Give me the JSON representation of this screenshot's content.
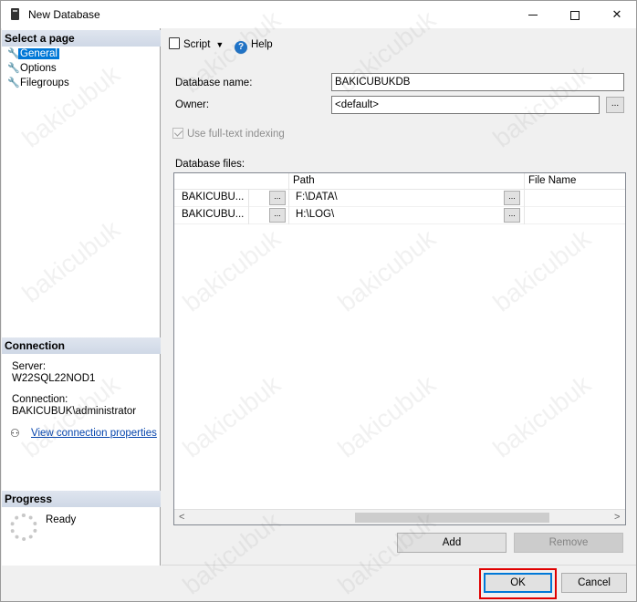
{
  "window": {
    "title": "New Database"
  },
  "left_pane": {
    "select_page_header": "Select a page",
    "pages": [
      {
        "label": "General",
        "selected": true
      },
      {
        "label": "Options",
        "selected": false
      },
      {
        "label": "Filegroups",
        "selected": false
      }
    ],
    "connection_header": "Connection",
    "server_label": "Server:",
    "server_value": "W22SQL22NOD1",
    "connection_label": "Connection:",
    "connection_value": "BAKICUBUK\\administrator",
    "view_connection_link": "View connection properties",
    "progress_header": "Progress",
    "progress_status": "Ready"
  },
  "toolbar": {
    "script_label": "Script",
    "help_label": "Help"
  },
  "form": {
    "database_name_label": "Database name:",
    "database_name_value": "BAKICUBUKDB",
    "owner_label": "Owner:",
    "owner_value": "<default>",
    "fulltext_label": "Use full-text indexing",
    "fulltext_checked": true,
    "database_files_label": "Database files:"
  },
  "files_grid": {
    "columns": [
      "",
      "Path",
      "File Name"
    ],
    "rows": [
      {
        "name": "BAKICUBU...",
        "path": "F:\\DATA\\"
      },
      {
        "name": "BAKICUBU...",
        "path": "H:\\LOG\\"
      }
    ],
    "ellipsis": "..."
  },
  "buttons": {
    "add": "Add",
    "remove": "Remove",
    "ok": "OK",
    "cancel": "Cancel"
  },
  "watermark_text": "bakicubuk"
}
